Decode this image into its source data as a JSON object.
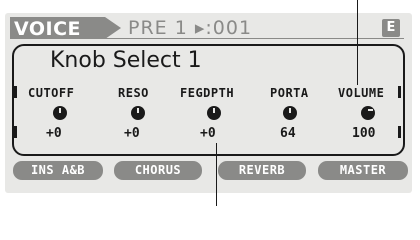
{
  "header": {
    "mode": "VOICE",
    "program": "PRE 1 ▸:001",
    "edit_icon": "E"
  },
  "panel": {
    "title": "Knob Select 1",
    "params": [
      {
        "label": "CUTOFF",
        "value": "+0",
        "knob": "knob-icon"
      },
      {
        "label": "RESO",
        "value": "+0",
        "knob": "knob-icon"
      },
      {
        "label": "FEGDPTH",
        "value": "+0",
        "knob": "knob-icon"
      },
      {
        "label": "PORTA",
        "value": "64",
        "knob": "knob-icon"
      },
      {
        "label": "VOLUME",
        "value": "100",
        "knob": "knob-icon"
      }
    ]
  },
  "buttons": [
    {
      "label": "INS A&B"
    },
    {
      "label": "CHORUS"
    },
    {
      "label": "REVERB"
    },
    {
      "label": "MASTER"
    }
  ],
  "colors": {
    "lcd_bg": "#e8e8e6",
    "ink": "#1a1a1a",
    "gray": "#8a8a88"
  }
}
